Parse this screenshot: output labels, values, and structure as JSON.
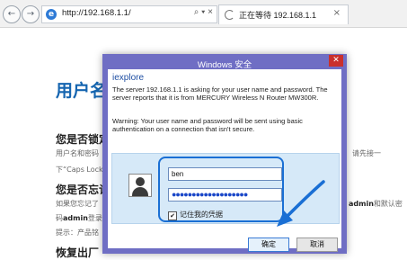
{
  "browser": {
    "back_icon": "back-arrow-icon",
    "forward_icon": "forward-arrow-icon",
    "url": "http://192.168.1.1/",
    "tool_glyphs": "⌕ ▾ ×",
    "tab_title": "正在等待 192.168.1.1",
    "tab_close": "×"
  },
  "page": {
    "title": "用户名",
    "sections": [
      {
        "heading": "您是否锁定",
        "lines": [
          "用户名和密码",
          "请先接一",
          "下“Caps Lock"
        ]
      },
      {
        "heading": "您是否忘记",
        "lines": [
          "如果您忘记了",
          "admin",
          "和默认密",
          "码",
          "admin",
          "登录",
          "提示：产品铭"
        ]
      },
      {
        "heading": "恢复出厂"
      }
    ]
  },
  "dialog": {
    "window_title": "Windows 安全",
    "close_glyph": "✕",
    "app_name": "iexplore",
    "message": "The server 192.168.1.1 is asking for your user name and password. The server reports that it is from MERCURY Wireless N Router MW300R.",
    "warning": "Warning: Your user name and password will be sent using basic authentication on a connection that isn't secure.",
    "username": "ben",
    "password_mask": "●●●●●●●●●●●●●●●●●●●",
    "remember_label": "记住我的凭据",
    "remember_checked": true,
    "ok_label": "确定",
    "cancel_label": "取消"
  },
  "colors": {
    "dialog_frame": "#6f6ec4",
    "panel": "#d6e9f8",
    "highlight": "#1a6fd4",
    "page_title": "#1565b0"
  }
}
